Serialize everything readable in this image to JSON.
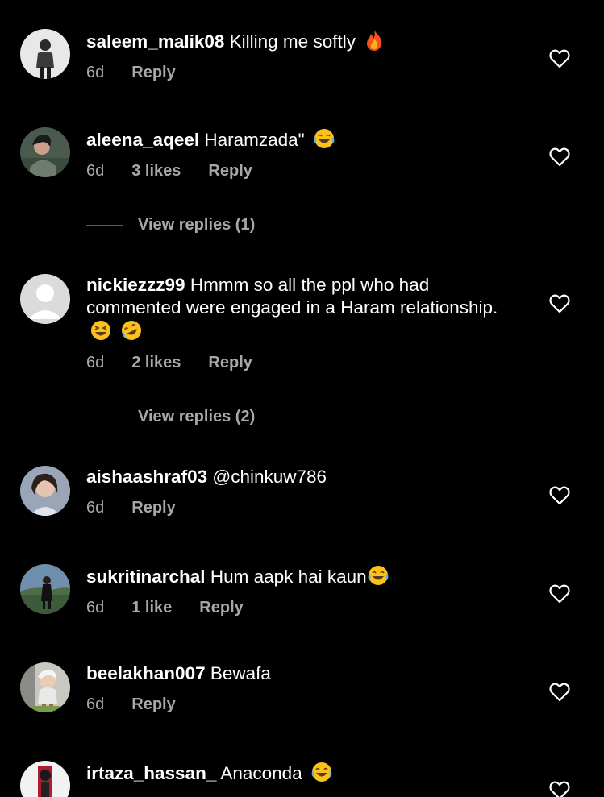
{
  "comments": [
    {
      "username": "saleem_malik08",
      "text": "Killing me softly",
      "emoji": [
        "fire-emoji"
      ],
      "time": "6d",
      "likes": "",
      "reply_label": "Reply",
      "avatar": "avatar-man-standing"
    },
    {
      "username": "aleena_aqeel",
      "text": "Haramzada\"",
      "emoji": [
        "joy-emoji"
      ],
      "time": "6d",
      "likes": "3 likes",
      "reply_label": "Reply",
      "avatar": "avatar-woman-portrait"
    },
    {
      "username": "nickiezzz99",
      "text": "Hmmm so all the ppl who had commented were engaged in a Haram relationship.",
      "emoji": [
        "laughing-emoji",
        "rofl-emoji"
      ],
      "time": "6d",
      "likes": "2 likes",
      "reply_label": "Reply",
      "avatar": "avatar-default-placeholder"
    },
    {
      "username": "aishaashraf03",
      "text": "@chinkuw786",
      "emoji": [],
      "time": "6d",
      "likes": "",
      "reply_label": "Reply",
      "avatar": "avatar-girl-portrait"
    },
    {
      "username": "sukritinarchal",
      "text": "Hum aapk hai kaun",
      "emoji": [
        "joy-emoji"
      ],
      "time": "6d",
      "likes": "1 like",
      "reply_label": "Reply",
      "avatar": "avatar-outdoor-person"
    },
    {
      "username": "beelakhan007",
      "text": "Bewafa",
      "emoji": [],
      "time": "6d",
      "likes": "",
      "reply_label": "Reply",
      "avatar": "avatar-child-portrait"
    },
    {
      "username": "irtaza_hassan_",
      "text": "Anaconda",
      "emoji": [
        "joy-emoji"
      ],
      "time": "",
      "likes": "",
      "reply_label": "",
      "avatar": "avatar-person-dark"
    }
  ],
  "view_replies": [
    {
      "label": "View replies (1)"
    },
    {
      "label": "View replies (2)"
    }
  ],
  "icons": {
    "like": "heart-outline-icon"
  },
  "colors": {
    "background": "#000000",
    "primary_text": "#ffffff",
    "secondary_text": "#a8a8a8",
    "reply_line": "#5a5a5a"
  }
}
